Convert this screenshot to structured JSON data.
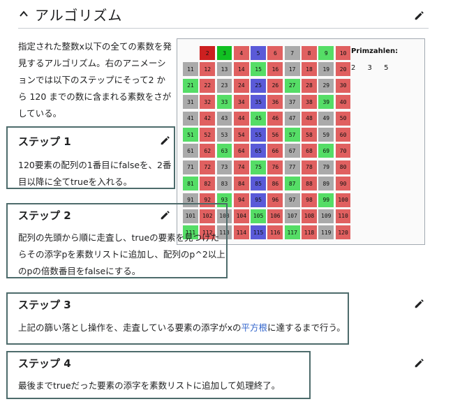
{
  "header": {
    "title": "アルゴリズム"
  },
  "intro": "指定された整数x以下の全ての素数を発見するアルゴリズム。右のアニメーションでは以下のステップにそって2 から 120 までの数に含まれる素数をさがしている。",
  "figure": {
    "legend_title": "Primzahlen:",
    "primes_found": "2 3 5",
    "grid_cells": [
      [
        null,
        "2",
        "3",
        "4",
        "5",
        "6",
        "7",
        "8",
        "9",
        "10"
      ],
      [
        "11",
        "12",
        "13",
        "14",
        "15",
        "16",
        "17",
        "18",
        "19",
        "20"
      ],
      [
        "21",
        "22",
        "23",
        "24",
        "25",
        "26",
        "27",
        "28",
        "29",
        "30"
      ],
      [
        "31",
        "32",
        "33",
        "34",
        "35",
        "36",
        "37",
        "38",
        "39",
        "40"
      ],
      [
        "41",
        "42",
        "43",
        "44",
        "45",
        "46",
        "47",
        "48",
        "49",
        "50"
      ],
      [
        "51",
        "52",
        "53",
        "54",
        "55",
        "56",
        "57",
        "58",
        "59",
        "60"
      ],
      [
        "61",
        "62",
        "63",
        "64",
        "65",
        "66",
        "67",
        "68",
        "69",
        "70"
      ],
      [
        "71",
        "72",
        "73",
        "74",
        "75",
        "76",
        "77",
        "78",
        "79",
        "80"
      ],
      [
        "81",
        "82",
        "83",
        "84",
        "85",
        "86",
        "87",
        "88",
        "89",
        "90"
      ],
      [
        "91",
        "92",
        "93",
        "94",
        "95",
        "96",
        "97",
        "98",
        "99",
        "100"
      ],
      [
        "101",
        "102",
        "103",
        "104",
        "105",
        "106",
        "107",
        "108",
        "109",
        "110"
      ],
      [
        "111",
        "112",
        "113",
        "114",
        "115",
        "116",
        "117",
        "118",
        "119",
        "120"
      ]
    ],
    "cell_state_colors": {
      "prime_current": "#cc2020",
      "prime_found": "#11c022",
      "multiple_of_2": "#e06060",
      "multiple_of_3": "#55dd66",
      "multiple_of_5": "#5a5ad8",
      "unmarked": "#aaaaaa"
    }
  },
  "steps": [
    {
      "title": "ステップ 1",
      "text": "120要素の配列の1番目にfalseを、2番目以降に全てtrueを入れる。"
    },
    {
      "title": "ステップ 2",
      "text": "配列の先頭から順に走査し、trueの要素を見つけたらその添字pを素数リストに追加し、配列のp^2以上のpの倍数番目をfalseにする。"
    },
    {
      "title": "ステップ 3",
      "text_before": "上記の篩い落とし操作を、走査している要素の添字がxの",
      "link": "平方根",
      "text_after": "に達するまで行う。"
    },
    {
      "title": "ステップ 4",
      "text": "最後までtrueだった要素の添字を素数リストに追加して処理終了。"
    }
  ],
  "icons": {
    "collapse": "chevron-up-icon",
    "edit": "pencil-icon"
  }
}
